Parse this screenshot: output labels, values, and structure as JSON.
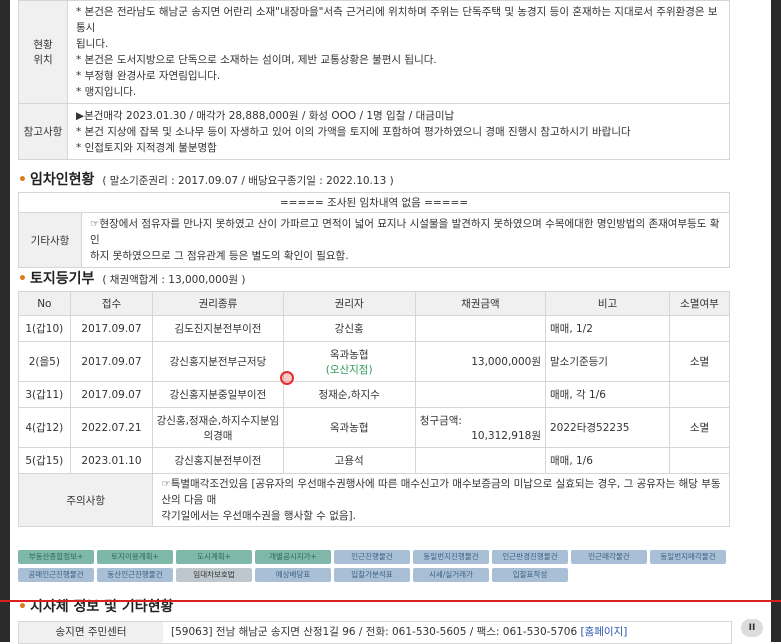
{
  "location": {
    "header": "현황\n위치",
    "lines": [
      "* 본건은 전라남도 해남군 송지면 어란리 소재\"내장마을\"서측 근거리에 위치하며 주위는 단독주택 및 농경지 등이 혼재하는 지대로서 주위환경은 보통시",
      "됩니다.",
      "* 본건은 도서지방으로 단독으로 소재하는 섬이며, 제반 교통상황은 불편시 됩니다.",
      "* 부정형 완경사로 자연림입니다.",
      "* 맹지입니다."
    ]
  },
  "reference": {
    "header": "참고사항",
    "lines": [
      "▶본건매각 2023.01.30 / 매각가 28,888,000원 / 화성 OOO / 1명 입찰 / 대금미납",
      "* 본건 지상에 잡목 및 소나무 등이 자생하고 있어 이의 가액을 토지에 포함하여 평가하였으니 경매 진행시 참고하시기 바랍니다",
      "* 인접토지와 지적경계 불분명함"
    ]
  },
  "tenant": {
    "title": "임차인현황",
    "sub": "( 말소기준권리 : 2017.09.07 / 배당요구종기일 : 2022.10.13 )",
    "none_text": "===== 조사된 임차내역 없음 =====",
    "etc_header": "기타사항",
    "etc_lines": [
      "☞현장에서 점유자를 만나지 못하였고 산이 가파르고 면적이 넓어 묘지나 시설물을 발견하지 못하였으며 수목에대한 명인방법의 존재여부등도 확인",
      "하지 못하였으므로 그 점유관계 등은 별도의 확인이 필요함."
    ]
  },
  "land": {
    "title": "토지등기부",
    "sub": "( 채권액합계 : 13,000,000원 )",
    "columns": [
      "No",
      "접수",
      "권리종류",
      "권리자",
      "채권금액",
      "비고",
      "소멸여부"
    ],
    "rows": [
      {
        "no": "1(갑10)",
        "date": "2017.09.07",
        "kind": "김도진지분전부이전",
        "holder": "강신홍",
        "holder2": "",
        "amount_label": "",
        "amount": "",
        "note": "매매, 1/2",
        "extinct": ""
      },
      {
        "no": "2(을5)",
        "date": "2017.09.07",
        "kind": "강신홍지분전부근저당",
        "holder": "옥과농협",
        "holder2": "(오산지점)",
        "amount_label": "",
        "amount": "13,000,000원",
        "note": "말소기준등기",
        "extinct": "소멸"
      },
      {
        "no": "3(갑11)",
        "date": "2017.09.07",
        "kind": "강신홍지분중일부이전",
        "holder": "정재순,하지수",
        "holder2": "",
        "amount_label": "",
        "amount": "",
        "note": "매매, 각 1/6",
        "extinct": ""
      },
      {
        "no": "4(갑12)",
        "date": "2022.07.21",
        "kind": "강신홍,정재순,하지수지분임의경매",
        "holder": "옥과농협",
        "holder2": "",
        "amount_label": "청구금액:",
        "amount": "10,312,918원",
        "note": "2022타경52235",
        "extinct": "소멸"
      },
      {
        "no": "5(갑15)",
        "date": "2023.01.10",
        "kind": "강신홍지분전부이전",
        "holder": "고용석",
        "holder2": "",
        "amount_label": "",
        "amount": "",
        "note": "매매, 1/6",
        "extinct": ""
      }
    ],
    "caution_header": "주의사항",
    "caution_lines": [
      "☞특별매각조건있음 [공유자의 우선매수권행사에 따른 매수신고가 매수보증금의 미납으로 실효되는 경우, 그 공유자는 해당 부동산의 다음 매",
      "각기일에서는 우선매수권을 행사할 수 없음]."
    ]
  },
  "buttons_row1": [
    {
      "label": "부동산종합정보+",
      "style": "green"
    },
    {
      "label": "토지이용계획+",
      "style": "green"
    },
    {
      "label": "도시계획+",
      "style": "green"
    },
    {
      "label": "개별공시지가+",
      "style": "green"
    },
    {
      "label": "인근진행물건",
      "style": "blue"
    },
    {
      "label": "동일번지진행물건",
      "style": "blue"
    },
    {
      "label": "인근반경진행물건",
      "style": "blue"
    },
    {
      "label": "인근매각물건",
      "style": "blue"
    },
    {
      "label": "동일번지매각물건",
      "style": "blue"
    }
  ],
  "buttons_row2": [
    {
      "label": "공매인근진행물건",
      "style": "blue"
    },
    {
      "label": "동산인근진행물건",
      "style": "blue"
    },
    {
      "label": "임대차보호법",
      "style": "gray"
    },
    {
      "label": "예상배당표",
      "style": "blue"
    },
    {
      "label": "입찰가분석표",
      "style": "blue"
    },
    {
      "label": "시세/실거래가",
      "style": "blue"
    },
    {
      "label": "입찰표작성",
      "style": "blue"
    }
  ],
  "bottom": {
    "title": "지자체 정보 및 기타현황",
    "row_header": "송지면 주민센터",
    "row_value": "[59063] 전남 해남군 송지면 산정1길 96 / 전화: 061-530-5605 / 팩스: 061-530-5706",
    "row_link": "[홈페이지]"
  },
  "player": {
    "pause_label": "II"
  }
}
